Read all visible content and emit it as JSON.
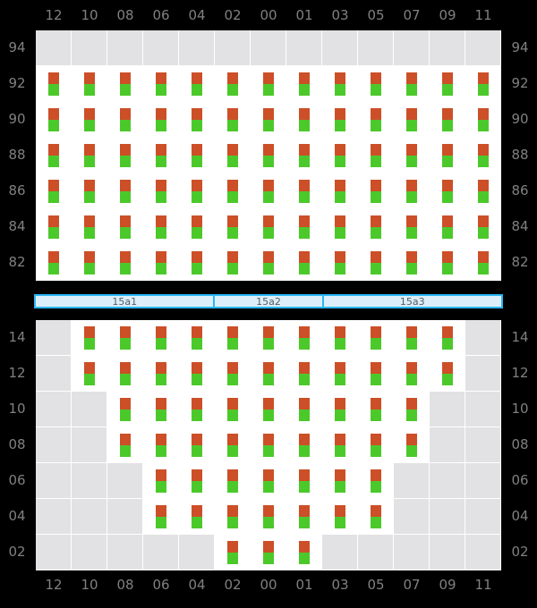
{
  "theme": {
    "background": "#000000",
    "cell_empty": "#e2e2e4",
    "cell_filled": "#ffffff",
    "marker_top": "#cc4f28",
    "marker_bottom": "#4cc92a",
    "label_color": "#808080",
    "divider_fill": "#ddeefb",
    "divider_border": "#29b6f6"
  },
  "columns": {
    "top_labels": [
      "12",
      "10",
      "08",
      "06",
      "04",
      "02",
      "00",
      "01",
      "03",
      "05",
      "07",
      "09",
      "11"
    ],
    "bottom_labels": [
      "12",
      "10",
      "08",
      "06",
      "04",
      "02",
      "00",
      "01",
      "03",
      "05",
      "07",
      "09",
      "11"
    ]
  },
  "panels": [
    {
      "id": "panel-top",
      "row_labels_left": [
        "94",
        "92",
        "90",
        "88",
        "86",
        "84",
        "82"
      ],
      "row_labels_right": [
        "94",
        "92",
        "90",
        "88",
        "86",
        "84",
        "82"
      ],
      "rows": [
        {
          "label": "94",
          "cells": [
            0,
            0,
            0,
            0,
            0,
            0,
            0,
            0,
            0,
            0,
            0,
            0,
            0
          ]
        },
        {
          "label": "92",
          "cells": [
            1,
            1,
            1,
            1,
            1,
            1,
            1,
            1,
            1,
            1,
            1,
            1,
            1
          ]
        },
        {
          "label": "90",
          "cells": [
            1,
            1,
            1,
            1,
            1,
            1,
            1,
            1,
            1,
            1,
            1,
            1,
            1
          ]
        },
        {
          "label": "88",
          "cells": [
            1,
            1,
            1,
            1,
            1,
            1,
            1,
            1,
            1,
            1,
            1,
            1,
            1
          ]
        },
        {
          "label": "86",
          "cells": [
            1,
            1,
            1,
            1,
            1,
            1,
            1,
            1,
            1,
            1,
            1,
            1,
            1
          ]
        },
        {
          "label": "84",
          "cells": [
            1,
            1,
            1,
            1,
            1,
            1,
            1,
            1,
            1,
            1,
            1,
            1,
            1
          ]
        },
        {
          "label": "82",
          "cells": [
            1,
            1,
            1,
            1,
            1,
            1,
            1,
            1,
            1,
            1,
            1,
            1,
            1
          ]
        }
      ]
    },
    {
      "id": "panel-bottom",
      "row_labels_left": [
        "14",
        "12",
        "10",
        "08",
        "06",
        "04",
        "02"
      ],
      "row_labels_right": [
        "14",
        "12",
        "10",
        "08",
        "06",
        "04",
        "02"
      ],
      "rows": [
        {
          "label": "14",
          "cells": [
            0,
            1,
            1,
            1,
            1,
            1,
            1,
            1,
            1,
            1,
            1,
            1,
            0
          ]
        },
        {
          "label": "12",
          "cells": [
            0,
            1,
            1,
            1,
            1,
            1,
            1,
            1,
            1,
            1,
            1,
            1,
            0
          ]
        },
        {
          "label": "10",
          "cells": [
            0,
            0,
            1,
            1,
            1,
            1,
            1,
            1,
            1,
            1,
            1,
            0,
            0
          ]
        },
        {
          "label": "08",
          "cells": [
            0,
            0,
            1,
            1,
            1,
            1,
            1,
            1,
            1,
            1,
            1,
            0,
            0
          ]
        },
        {
          "label": "06",
          "cells": [
            0,
            0,
            0,
            1,
            1,
            1,
            1,
            1,
            1,
            1,
            0,
            0,
            0
          ]
        },
        {
          "label": "04",
          "cells": [
            0,
            0,
            0,
            1,
            1,
            1,
            1,
            1,
            1,
            1,
            0,
            0,
            0
          ]
        },
        {
          "label": "02",
          "cells": [
            0,
            0,
            0,
            0,
            0,
            1,
            1,
            1,
            0,
            0,
            0,
            0,
            0
          ]
        }
      ]
    }
  ],
  "divider": {
    "segments": [
      {
        "label": "15a1",
        "span": 5
      },
      {
        "label": "15a2",
        "span": 3
      },
      {
        "label": "15a3",
        "span": 5
      }
    ]
  },
  "chart_data": {
    "type": "heatmap",
    "title": "",
    "xlabel": "",
    "ylabel": "",
    "grid": true,
    "legend": "none",
    "x_categories": [
      "12",
      "10",
      "08",
      "06",
      "04",
      "02",
      "00",
      "01",
      "03",
      "05",
      "07",
      "09",
      "11"
    ],
    "panels": [
      {
        "name": "upper-grid",
        "y_categories": [
          "94",
          "92",
          "90",
          "88",
          "86",
          "84",
          "82"
        ],
        "values": [
          [
            0,
            0,
            0,
            0,
            0,
            0,
            0,
            0,
            0,
            0,
            0,
            0,
            0
          ],
          [
            1,
            1,
            1,
            1,
            1,
            1,
            1,
            1,
            1,
            1,
            1,
            1,
            1
          ],
          [
            1,
            1,
            1,
            1,
            1,
            1,
            1,
            1,
            1,
            1,
            1,
            1,
            1
          ],
          [
            1,
            1,
            1,
            1,
            1,
            1,
            1,
            1,
            1,
            1,
            1,
            1,
            1
          ],
          [
            1,
            1,
            1,
            1,
            1,
            1,
            1,
            1,
            1,
            1,
            1,
            1,
            1
          ],
          [
            1,
            1,
            1,
            1,
            1,
            1,
            1,
            1,
            1,
            1,
            1,
            1,
            1
          ],
          [
            1,
            1,
            1,
            1,
            1,
            1,
            1,
            1,
            1,
            1,
            1,
            1,
            1
          ]
        ]
      },
      {
        "name": "lower-grid",
        "y_categories": [
          "14",
          "12",
          "10",
          "08",
          "06",
          "04",
          "02"
        ],
        "values": [
          [
            0,
            1,
            1,
            1,
            1,
            1,
            1,
            1,
            1,
            1,
            1,
            1,
            0
          ],
          [
            0,
            1,
            1,
            1,
            1,
            1,
            1,
            1,
            1,
            1,
            1,
            1,
            0
          ],
          [
            0,
            0,
            1,
            1,
            1,
            1,
            1,
            1,
            1,
            1,
            1,
            0,
            0
          ],
          [
            0,
            0,
            1,
            1,
            1,
            1,
            1,
            1,
            1,
            1,
            1,
            0,
            0
          ],
          [
            0,
            0,
            0,
            1,
            1,
            1,
            1,
            1,
            1,
            1,
            0,
            0,
            0
          ],
          [
            0,
            0,
            0,
            1,
            1,
            1,
            1,
            1,
            1,
            1,
            0,
            0,
            0
          ],
          [
            0,
            0,
            0,
            0,
            0,
            1,
            1,
            1,
            0,
            0,
            0,
            0,
            0
          ]
        ]
      }
    ],
    "group_bands": [
      "15a1",
      "15a2",
      "15a3"
    ]
  }
}
